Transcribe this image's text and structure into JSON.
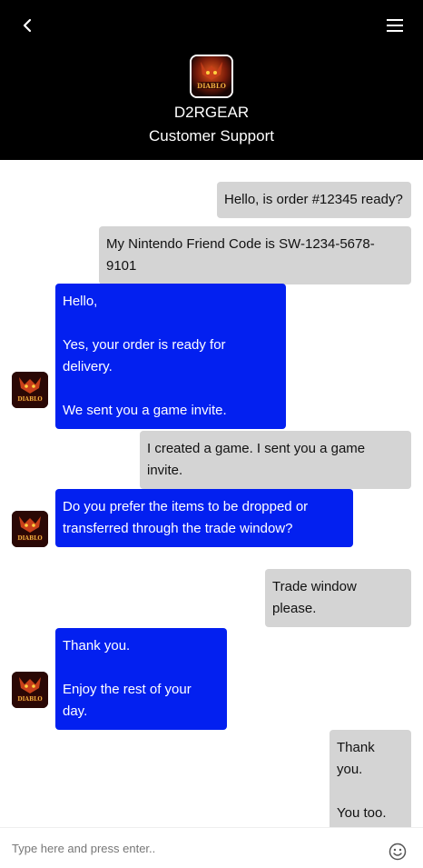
{
  "header": {
    "brand_name": "D2RGEAR",
    "subtitle": "Customer Support",
    "logo_text": "DIABLO II",
    "back_icon": "back-chevron-icon",
    "menu_icon": "hamburger-menu-icon"
  },
  "messages": [
    {
      "sender": "user",
      "text": "Hello, is order #12345 ready?"
    },
    {
      "sender": "user",
      "text": "My Nintendo Friend Code is SW-1234-5678-9101"
    },
    {
      "sender": "agent",
      "text": "Hello,\n\nYes, your order is ready for delivery.\n\nWe sent you a game invite."
    },
    {
      "sender": "user",
      "text": "I created a game. I sent you a game invite."
    },
    {
      "sender": "agent",
      "text": "Do you prefer the items to be dropped or\ntransferred through the trade window?"
    },
    {
      "sender": "user",
      "text": "Trade window please."
    },
    {
      "sender": "agent",
      "text": "Thank you.\n\nEnjoy the rest of your day."
    },
    {
      "sender": "user",
      "text": "Thank you.\n\nYou too."
    }
  ],
  "composer": {
    "placeholder": "Type here and press enter..",
    "emoji_icon": "smiley-emoji-icon"
  },
  "colors": {
    "header_bg": "#000000",
    "agent_bubble": "#0320f0",
    "user_bubble": "#d4d4d4"
  }
}
